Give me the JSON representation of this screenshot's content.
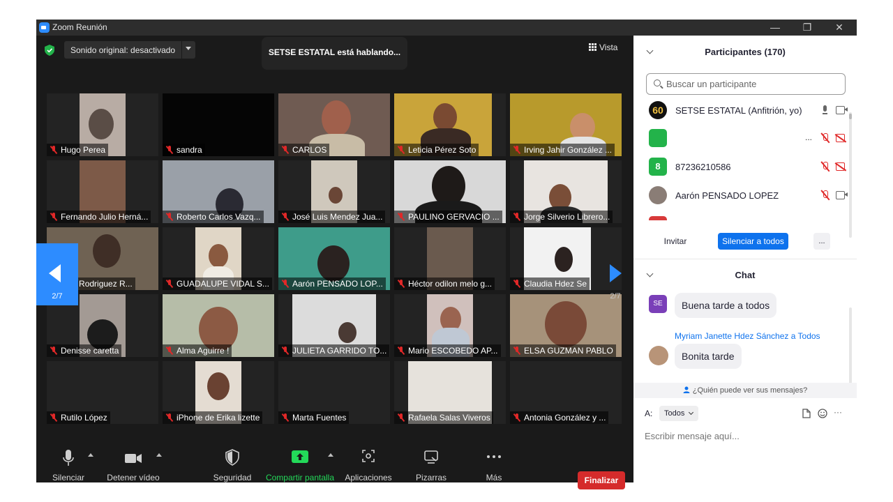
{
  "window": {
    "title": "Zoom Reunión",
    "controls": {
      "minimize": "—",
      "restore": "❐",
      "close": "✕"
    }
  },
  "stage": {
    "audio_dropdown": "Sonido original: desactivado",
    "speaking_banner": "SETSE ESTATAL está hablando...",
    "view_label": "Vista",
    "page_left": "2/7",
    "page_right": "2/7"
  },
  "gallery": [
    {
      "name": "Hugo Perea"
    },
    {
      "name": "sandra"
    },
    {
      "name": "CARLOS"
    },
    {
      "name": "Leticia Pérez Soto"
    },
    {
      "name": "Irving Jahir González ..."
    },
    {
      "name": "Fernando Julio Herná..."
    },
    {
      "name": "Roberto Carlos Vazq..."
    },
    {
      "name": "José Luis Mendez Jua..."
    },
    {
      "name": "PAULINO GERVACIO ..."
    },
    {
      "name": "Jorge Silverio Librero..."
    },
    {
      "name": "udio Rodriguez R..."
    },
    {
      "name": "GUADALUPE VIDAL S..."
    },
    {
      "name": "Aarón PENSADO LOP..."
    },
    {
      "name": "Héctor odilon melo g..."
    },
    {
      "name": "Claudia Hdez Se"
    },
    {
      "name": "Denisse caretta"
    },
    {
      "name": "Alma Aguirre !"
    },
    {
      "name": "JULIETA GARRIDO TO..."
    },
    {
      "name": "Mario ESCOBEDO AP..."
    },
    {
      "name": "ELSA GUZMAN PABLO"
    },
    {
      "name": "Rutilo López"
    },
    {
      "name": "iPhone de Erika lizette"
    },
    {
      "name": "Marta Fuentes"
    },
    {
      "name": "Rafaela Salas Viveros"
    },
    {
      "name": "Antonia González y ..."
    }
  ],
  "toolbar": {
    "mute": "Silenciar",
    "video": "Detener vídeo",
    "security": "Seguridad",
    "share": "Compartir pantalla",
    "apps": "Aplicaciones",
    "whiteboards": "Pizarras",
    "more": "Más",
    "end": "Finalizar"
  },
  "participants": {
    "header": "Participantes (170)",
    "search_placeholder": "Buscar un participante",
    "list": [
      {
        "name": "SETSE ESTATAL (Anfitrión, yo)",
        "avatar_text": "60"
      },
      {
        "name": "",
        "avatar_text": "",
        "extra": "..."
      },
      {
        "name": "87236210586",
        "avatar_text": "8"
      },
      {
        "name": "Aarón PENSADO LOPEZ",
        "avatar_text": ""
      }
    ],
    "invite": "Invitar",
    "mute_all": "Silenciar a todos",
    "more": "..."
  },
  "chat": {
    "header": "Chat",
    "messages": [
      {
        "avatar": "SE",
        "sender": "",
        "text": "Buena tarde a todos"
      },
      {
        "avatar": "",
        "sender": "Myriam Janette Hdez Sánchez a Todos",
        "text": "Bonita tarde"
      }
    ],
    "privacy": "¿Quién puede ver sus mensajes?",
    "to_label": "A:",
    "to_value": "Todos",
    "input_placeholder": "Escribir mensaje aquí...",
    "more": "···"
  },
  "colors": {
    "accent": "#2d8cff",
    "end_red": "#d52b2b",
    "share_green": "#23d959",
    "muted_red": "#e02828"
  }
}
